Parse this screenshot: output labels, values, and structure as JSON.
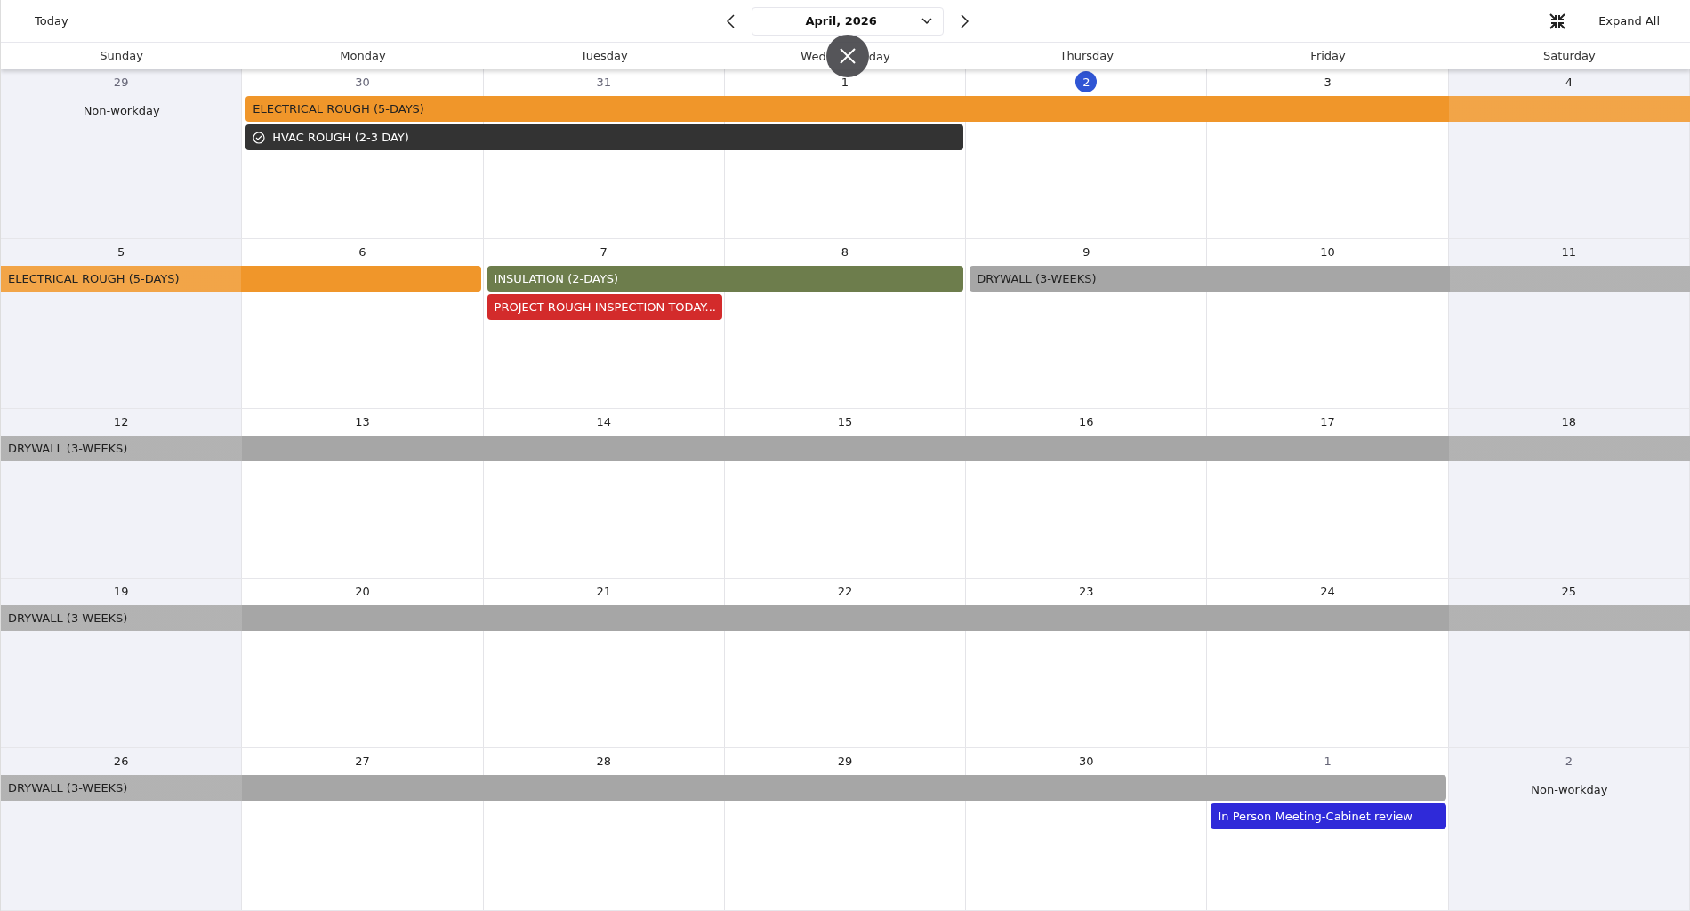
{
  "toolbar": {
    "today_button": "Today",
    "month": "April, 2026",
    "expand_button": "Expand All"
  },
  "weekdays": [
    [
      "Sunday"
    ],
    [
      "Monday"
    ],
    [
      "Tuesday"
    ],
    [
      "Wed",
      "day"
    ],
    [
      "Thursday"
    ],
    [
      "Friday"
    ],
    [
      "Saturday"
    ]
  ],
  "weeks": [
    {
      "days": [
        {
          "date": "29",
          "other_month": true,
          "non_workday": true,
          "today": false,
          "note": "Non-workday"
        },
        {
          "date": "30",
          "other_month": true,
          "non_workday": false,
          "today": false
        },
        {
          "date": "31",
          "other_month": true,
          "non_workday": false,
          "today": false
        },
        {
          "date": "1",
          "other_month": false,
          "non_workday": false,
          "today": false
        },
        {
          "date": "2",
          "other_month": false,
          "non_workday": false,
          "today": true
        },
        {
          "date": "3",
          "other_month": false,
          "non_workday": false,
          "today": false
        },
        {
          "date": "4",
          "other_month": false,
          "non_workday": true,
          "today": false
        }
      ],
      "lanes": [
        [
          {
            "kind": "gap"
          },
          {
            "kind": "start",
            "label": "ELECTRICAL ROUGH (5-DAYS)",
            "color": "#f0962a",
            "done": false
          },
          {
            "kind": "more"
          },
          {
            "kind": "more"
          },
          {
            "kind": "more"
          },
          {
            "kind": "more"
          },
          {
            "kind": "more"
          }
        ],
        [
          {
            "kind": "gap"
          },
          {
            "kind": "start",
            "label": "HVAC ROUGH (2-3 DAY)",
            "color": "#333333",
            "done": true
          },
          {
            "kind": "more"
          },
          {
            "kind": "more"
          },
          {
            "kind": "gap"
          },
          {
            "kind": "gap"
          },
          {
            "kind": "gap"
          }
        ]
      ]
    },
    {
      "days": [
        {
          "date": "5",
          "other_month": false,
          "non_workday": true,
          "today": false
        },
        {
          "date": "6",
          "other_month": false,
          "non_workday": false,
          "today": false
        },
        {
          "date": "7",
          "other_month": false,
          "non_workday": false,
          "today": false
        },
        {
          "date": "8",
          "other_month": false,
          "non_workday": false,
          "today": false
        },
        {
          "date": "9",
          "other_month": false,
          "non_workday": false,
          "today": false
        },
        {
          "date": "10",
          "other_month": false,
          "non_workday": false,
          "today": false
        },
        {
          "date": "11",
          "other_month": false,
          "non_workday": true,
          "today": false
        }
      ],
      "lanes": [
        [
          {
            "kind": "start",
            "label": "ELECTRICAL ROUGH (5-DAYS)",
            "color": "#f0962a",
            "done": false
          },
          {
            "kind": "more"
          },
          {
            "kind": "start",
            "label": "INSULATION (2-DAYS)",
            "color": "#6d7d4c",
            "done": false
          },
          {
            "kind": "more"
          },
          {
            "kind": "start",
            "label": "DRYWALL (3-WEEKS)",
            "color": "#a6a6a6",
            "done": false
          },
          {
            "kind": "more"
          },
          {
            "kind": "more"
          }
        ],
        [
          {
            "kind": "gap"
          },
          {
            "kind": "gap"
          },
          {
            "kind": "start",
            "label": "PROJECT ROUGH INSPECTION TODAY...",
            "color": "#d32b2b",
            "done": false
          },
          {
            "kind": "gap"
          },
          {
            "kind": "gap"
          },
          {
            "kind": "gap"
          },
          {
            "kind": "gap"
          }
        ]
      ]
    },
    {
      "days": [
        {
          "date": "12",
          "other_month": false,
          "non_workday": true,
          "today": false
        },
        {
          "date": "13",
          "other_month": false,
          "non_workday": false,
          "today": false
        },
        {
          "date": "14",
          "other_month": false,
          "non_workday": false,
          "today": false
        },
        {
          "date": "15",
          "other_month": false,
          "non_workday": false,
          "today": false
        },
        {
          "date": "16",
          "other_month": false,
          "non_workday": false,
          "today": false
        },
        {
          "date": "17",
          "other_month": false,
          "non_workday": false,
          "today": false
        },
        {
          "date": "18",
          "other_month": false,
          "non_workday": true,
          "today": false
        }
      ],
      "lanes": [
        [
          {
            "kind": "start",
            "label": "DRYWALL (3-WEEKS)",
            "color": "#a6a6a6",
            "done": false
          },
          {
            "kind": "more"
          },
          {
            "kind": "more"
          },
          {
            "kind": "more"
          },
          {
            "kind": "more"
          },
          {
            "kind": "more"
          },
          {
            "kind": "more"
          }
        ]
      ]
    },
    {
      "days": [
        {
          "date": "19",
          "other_month": false,
          "non_workday": true,
          "today": false
        },
        {
          "date": "20",
          "other_month": false,
          "non_workday": false,
          "today": false
        },
        {
          "date": "21",
          "other_month": false,
          "non_workday": false,
          "today": false
        },
        {
          "date": "22",
          "other_month": false,
          "non_workday": false,
          "today": false
        },
        {
          "date": "23",
          "other_month": false,
          "non_workday": false,
          "today": false
        },
        {
          "date": "24",
          "other_month": false,
          "non_workday": false,
          "today": false
        },
        {
          "date": "25",
          "other_month": false,
          "non_workday": true,
          "today": false
        }
      ],
      "lanes": [
        [
          {
            "kind": "start",
            "label": "DRYWALL (3-WEEKS)",
            "color": "#a6a6a6",
            "done": false
          },
          {
            "kind": "more"
          },
          {
            "kind": "more"
          },
          {
            "kind": "more"
          },
          {
            "kind": "more"
          },
          {
            "kind": "more"
          },
          {
            "kind": "more"
          }
        ]
      ]
    },
    {
      "days": [
        {
          "date": "26",
          "other_month": false,
          "non_workday": true,
          "today": false
        },
        {
          "date": "27",
          "other_month": false,
          "non_workday": false,
          "today": false
        },
        {
          "date": "28",
          "other_month": false,
          "non_workday": false,
          "today": false
        },
        {
          "date": "29",
          "other_month": false,
          "non_workday": false,
          "today": false
        },
        {
          "date": "30",
          "other_month": false,
          "non_workday": false,
          "today": false
        },
        {
          "date": "1",
          "other_month": true,
          "non_workday": false,
          "today": false
        },
        {
          "date": "2",
          "other_month": true,
          "non_workday": true,
          "today": false,
          "note": "Non-workday"
        }
      ],
      "lanes": [
        [
          {
            "kind": "start",
            "label": "DRYWALL (3-WEEKS)",
            "color": "#a6a6a6",
            "done": false
          },
          {
            "kind": "more"
          },
          {
            "kind": "more"
          },
          {
            "kind": "more"
          },
          {
            "kind": "more"
          },
          {
            "kind": "more"
          },
          {
            "kind": "gap"
          }
        ],
        [
          {
            "kind": "gap"
          },
          {
            "kind": "gap"
          },
          {
            "kind": "gap"
          },
          {
            "kind": "gap"
          },
          {
            "kind": "gap"
          },
          {
            "kind": "start",
            "label": "In Person Meeting-Cabinet review",
            "color": "#2f2ad9",
            "done": false
          },
          {
            "kind": "gap"
          }
        ]
      ]
    }
  ]
}
